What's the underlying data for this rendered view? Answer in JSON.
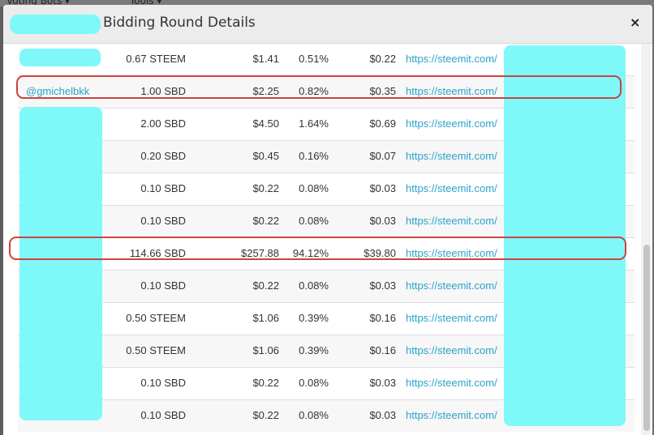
{
  "background": {
    "menu_items": [
      "Voting Bots ▾",
      "Tools ▾"
    ]
  },
  "modal": {
    "title": "Bidding Round Details",
    "close_label": "×"
  },
  "rows": [
    {
      "user": "",
      "amount": "0.67 STEEM",
      "usd": "$1.41",
      "percent": "0.51%",
      "value": "$0.22",
      "url": "https://steemit.com/"
    },
    {
      "user": "@gmichelbkk",
      "amount": "1.00 SBD",
      "usd": "$2.25",
      "percent": "0.82%",
      "value": "$0.35",
      "url": "https://steemit.com/"
    },
    {
      "user": "",
      "amount": "2.00 SBD",
      "usd": "$4.50",
      "percent": "1.64%",
      "value": "$0.69",
      "url": "https://steemit.com/"
    },
    {
      "user": "",
      "amount": "0.20 SBD",
      "usd": "$0.45",
      "percent": "0.16%",
      "value": "$0.07",
      "url": "https://steemit.com/"
    },
    {
      "user": "",
      "amount": "0.10 SBD",
      "usd": "$0.22",
      "percent": "0.08%",
      "value": "$0.03",
      "url": "https://steemit.com/"
    },
    {
      "user": "",
      "amount": "0.10 SBD",
      "usd": "$0.22",
      "percent": "0.08%",
      "value": "$0.03",
      "url": "https://steemit.com/"
    },
    {
      "user": "",
      "amount": "114.66 SBD",
      "usd": "$257.88",
      "percent": "94.12%",
      "value": "$39.80",
      "url": "https://steemit.com/"
    },
    {
      "user": "",
      "amount": "0.10 SBD",
      "usd": "$0.22",
      "percent": "0.08%",
      "value": "$0.03",
      "url": "https://steemit.com/"
    },
    {
      "user": "",
      "amount": "0.50 STEEM",
      "usd": "$1.06",
      "percent": "0.39%",
      "value": "$0.16",
      "url": "https://steemit.com/"
    },
    {
      "user": "",
      "amount": "0.50 STEEM",
      "usd": "$1.06",
      "percent": "0.39%",
      "value": "$0.16",
      "url": "https://steemit.com/"
    },
    {
      "user": "",
      "amount": "0.10 SBD",
      "usd": "$0.22",
      "percent": "0.08%",
      "value": "$0.03",
      "url": "https://steemit.com/"
    },
    {
      "user": "",
      "amount": "0.10 SBD",
      "usd": "$0.22",
      "percent": "0.08%",
      "value": "$0.03",
      "url": "https://steemit.com/"
    }
  ],
  "colors": {
    "link": "#2aa3c8",
    "highlight": "#c9443e",
    "redaction": "#7ff8fa"
  }
}
